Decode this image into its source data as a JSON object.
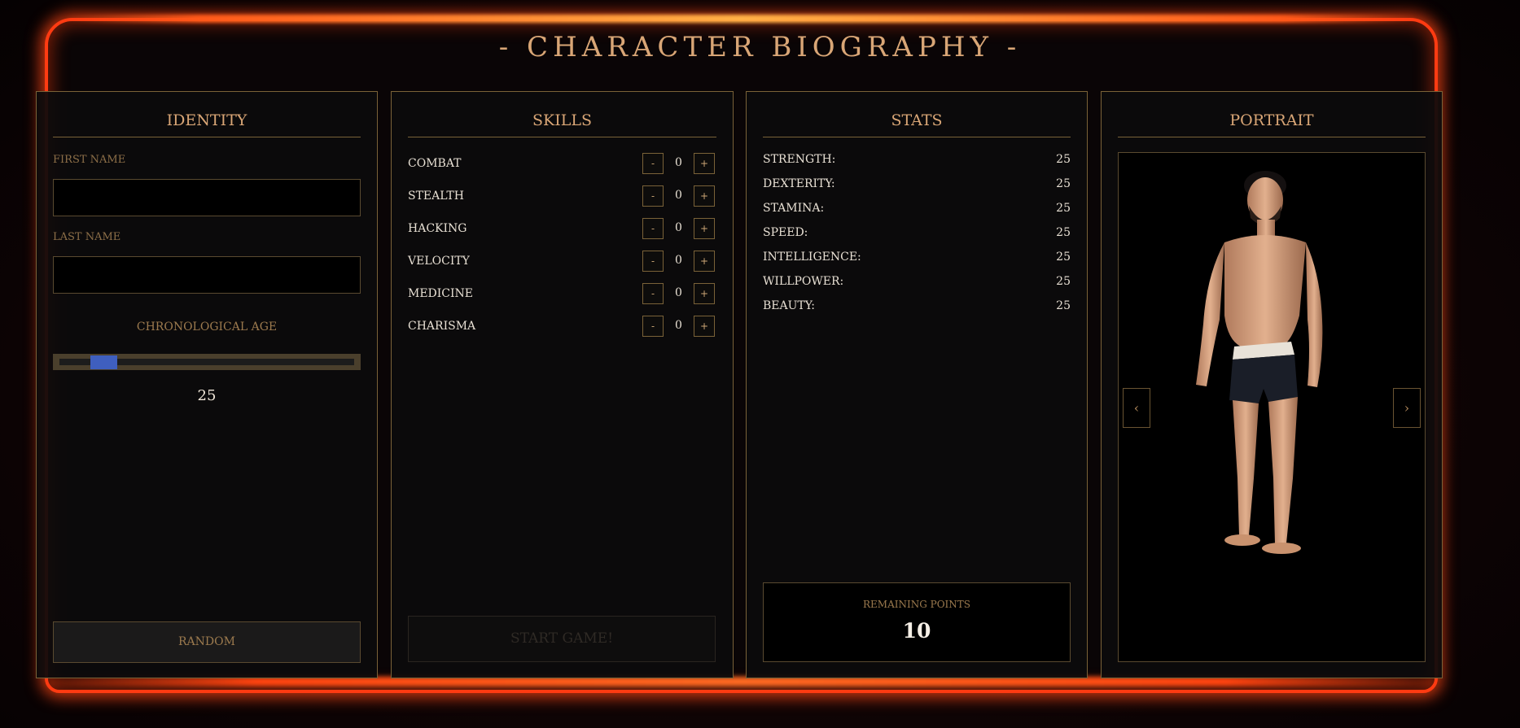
{
  "title": "- CHARACTER BIOGRAPHY -",
  "identity": {
    "title": "IDENTITY",
    "first_name_label": "FIRST NAME",
    "first_name_value": "",
    "last_name_label": "LAST NAME",
    "last_name_value": "",
    "age_label": "CHRONOLOGICAL AGE",
    "age_value": "25",
    "random_label": "RANDOM"
  },
  "skills": {
    "title": "SKILLS",
    "items": [
      {
        "name": "COMBAT",
        "value": "0"
      },
      {
        "name": "STEALTH",
        "value": "0"
      },
      {
        "name": "HACKING",
        "value": "0"
      },
      {
        "name": "VELOCITY",
        "value": "0"
      },
      {
        "name": "MEDICINE",
        "value": "0"
      },
      {
        "name": "CHARISMA",
        "value": "0"
      }
    ],
    "minus_label": "-",
    "plus_label": "+",
    "start_label": "START GAME!"
  },
  "stats": {
    "title": "STATS",
    "items": [
      {
        "name": "STRENGTH:",
        "value": "25"
      },
      {
        "name": "DEXTERITY:",
        "value": "25"
      },
      {
        "name": "STAMINA:",
        "value": "25"
      },
      {
        "name": "SPEED:",
        "value": "25"
      },
      {
        "name": "INTELLIGENCE:",
        "value": "25"
      },
      {
        "name": "WILLPOWER:",
        "value": "25"
      },
      {
        "name": "BEAUTY:",
        "value": "25"
      }
    ],
    "remaining_label": "REMAINING POINTS",
    "remaining_value": "10"
  },
  "portrait": {
    "title": "PORTRAIT",
    "prev_icon": "‹",
    "next_icon": "›"
  },
  "colors": {
    "accent_gold": "#d9a676",
    "frame_glow": "#ff3b12",
    "slider_thumb": "#3f5fbf"
  }
}
